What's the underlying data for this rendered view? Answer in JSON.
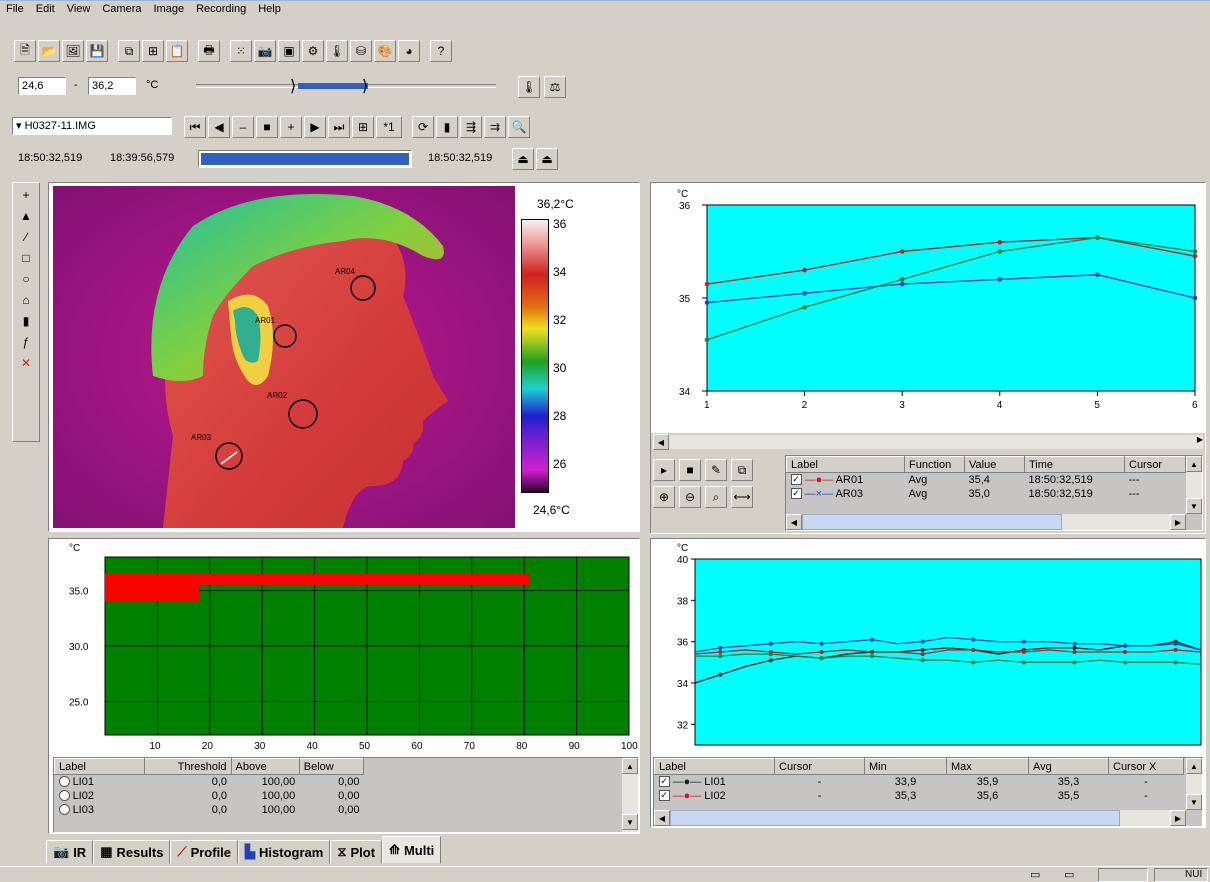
{
  "menu": [
    "File",
    "Edit",
    "View",
    "Camera",
    "Image",
    "Recording",
    "Help"
  ],
  "range": {
    "min": "24,6",
    "max": "36,2",
    "unit": "°C",
    "dash": "-"
  },
  "file": {
    "name": "H0327-11.IMG",
    "frame": "*1"
  },
  "times": {
    "t1": "18:50:32,519",
    "t2": "18:39:56,579",
    "t3": "18:50:32,519"
  },
  "ir": {
    "scale_top": "36,2°C",
    "scale_bottom": "24,6°C",
    "scale_ticks": [
      "36",
      "34",
      "32",
      "30",
      "28",
      "26"
    ],
    "rois": [
      "AR04",
      "AR01",
      "AR02",
      "AR03"
    ]
  },
  "plot1": {
    "unit": "°C"
  },
  "plot1_table": {
    "headers": [
      "Label",
      "Function",
      "Value",
      "Time",
      "Cursor"
    ],
    "rows": [
      {
        "label": "AR01",
        "function": "Avg",
        "value": "35,4",
        "time": "18:50:32,519",
        "cursor": "---"
      },
      {
        "label": "AR03",
        "function": "Avg",
        "value": "35,0",
        "time": "18:50:32,519",
        "cursor": "---"
      }
    ]
  },
  "hist": {
    "unit": "°C"
  },
  "hist_table": {
    "headers": [
      "Label",
      "Threshold",
      "Above",
      "Below"
    ],
    "rows": [
      {
        "label": "LI01",
        "threshold": "0,0",
        "above": "100,00",
        "below": "0,00"
      },
      {
        "label": "LI02",
        "threshold": "0,0",
        "above": "100,00",
        "below": "0,00"
      },
      {
        "label": "LI03",
        "threshold": "0,0",
        "above": "100,00",
        "below": "0,00"
      }
    ]
  },
  "plot2": {
    "unit": "°C"
  },
  "plot2_table": {
    "headers": [
      "Label",
      "Cursor",
      "Min",
      "Max",
      "Avg",
      "Cursor X"
    ],
    "rows": [
      {
        "label": "LI01",
        "cursor": "-",
        "min": "33,9",
        "max": "35,9",
        "avg": "35,3",
        "cursorx": "-"
      },
      {
        "label": "LI02",
        "cursor": "-",
        "min": "35,3",
        "max": "35,6",
        "avg": "35,5",
        "cursorx": "-"
      }
    ]
  },
  "tabs": [
    "IR",
    "Results",
    "Profile",
    "Histogram",
    "Plot",
    "Multi"
  ],
  "status": {
    "num": "NUI"
  },
  "colors": {
    "plot_bg": "#00ffff",
    "hist_bg": "#008000",
    "hist_bar": "#ff0000",
    "line_red": "#c02020",
    "line_blue": "#2040c0",
    "line_green": "#208040"
  },
  "chart_data": [
    {
      "type": "line",
      "ylabel": "°C",
      "x": [
        1,
        2,
        3,
        4,
        5,
        6
      ],
      "xlim": [
        1,
        6
      ],
      "ylim": [
        34,
        36
      ],
      "yticks": [
        34,
        35,
        36
      ],
      "yticklabels": [
        "34",
        "35",
        "36"
      ],
      "series": [
        {
          "name": "AR01",
          "color": "#c02020",
          "values": [
            35.15,
            35.3,
            35.5,
            35.6,
            35.65,
            35.45
          ]
        },
        {
          "name": "AR03",
          "color": "#2040c0",
          "values": [
            34.95,
            35.05,
            35.15,
            35.2,
            35.25,
            35.0
          ]
        },
        {
          "color": "#208040",
          "values": [
            34.55,
            34.9,
            35.2,
            35.5,
            35.65,
            35.5
          ]
        }
      ]
    },
    {
      "type": "bar",
      "ylabel": "°C",
      "xlim": [
        0,
        100
      ],
      "ylim": [
        22,
        38
      ],
      "xticks": [
        10,
        20,
        30,
        40,
        50,
        60,
        70,
        80,
        90,
        100
      ],
      "yticks": [
        25,
        30,
        35
      ],
      "yticklabels": [
        "25.0",
        "30.0",
        "35.0"
      ],
      "bars": [
        {
          "y_low": 35.5,
          "y_high": 36.5,
          "x_end": 81
        },
        {
          "y_low": 34.0,
          "y_high": 35.5,
          "x_end": 18
        }
      ]
    },
    {
      "type": "line",
      "ylabel": "°C",
      "xlim": [
        0,
        20
      ],
      "ylim": [
        31,
        40
      ],
      "yticks": [
        32,
        34,
        36,
        38,
        40
      ],
      "series": [
        {
          "name": "LI01",
          "color": "#202020",
          "values": [
            34.0,
            34.4,
            34.8,
            35.1,
            35.3,
            35.2,
            35.4,
            35.5,
            35.5,
            35.6,
            35.7,
            35.6,
            35.4,
            35.6,
            35.7,
            35.7,
            35.6,
            35.8,
            35.8,
            36.0,
            35.6
          ]
        },
        {
          "name": "LI02",
          "color": "#c02020",
          "values": [
            35.4,
            35.5,
            35.6,
            35.5,
            35.4,
            35.5,
            35.6,
            35.5,
            35.5,
            35.4,
            35.6,
            35.6,
            35.5,
            35.5,
            35.6,
            35.5,
            35.5,
            35.5,
            35.5,
            35.6,
            35.5
          ]
        },
        {
          "color": "#2040c0",
          "values": [
            35.5,
            35.7,
            35.8,
            35.9,
            36.0,
            35.9,
            36.0,
            36.1,
            35.9,
            36.0,
            36.2,
            36.1,
            36.0,
            36.0,
            36.0,
            35.9,
            35.9,
            35.8,
            35.8,
            35.9,
            35.6
          ]
        },
        {
          "color": "#208040",
          "values": [
            35.3,
            35.3,
            35.4,
            35.4,
            35.3,
            35.2,
            35.3,
            35.3,
            35.2,
            35.1,
            35.1,
            35.0,
            35.1,
            35.0,
            35.0,
            35.0,
            35.1,
            35.0,
            35.0,
            35.0,
            34.9
          ]
        }
      ]
    }
  ]
}
